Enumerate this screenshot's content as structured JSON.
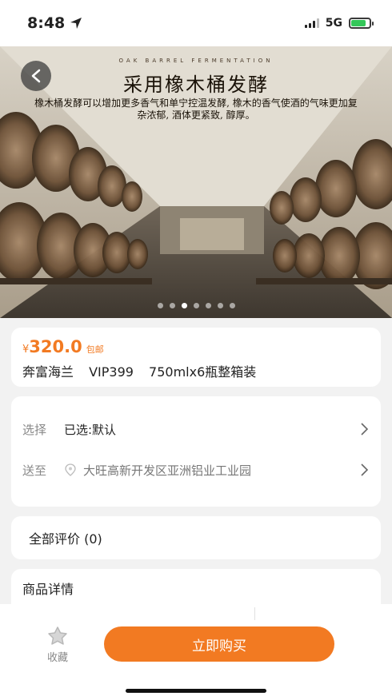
{
  "status": {
    "time": "8:48",
    "network": "5G",
    "battery_level": 0.8
  },
  "hero": {
    "subtitle": "OAK BARREL FERMENTATION",
    "title": "采用橡木桶发酵",
    "description": "橡木桶发酵可以增加更多香气和单宁控温发酵, 橡木的香气使酒的气味更加复杂浓郁, 酒体更紧致, 醇厚。",
    "slide_count": 7,
    "active_slide": 2
  },
  "product": {
    "currency": "¥",
    "price": "320.0",
    "shipping_tag": "包邮",
    "name": "奔富海兰 VIP399 750mlx6瓶整箱装"
  },
  "options": {
    "select_label": "选择",
    "select_value": "已选:默认",
    "ship_label": "送至",
    "ship_value": "大旺高新开发区亚洲铝业工业园"
  },
  "reviews": {
    "label": "全部评价 (0)"
  },
  "details": {
    "label": "商品详情"
  },
  "bottom": {
    "favorite_label": "收藏",
    "buy_label": "立即购买"
  },
  "colors": {
    "accent": "#f27a22",
    "background": "#f2f2f2"
  },
  "icons": [
    "location-arrow-icon",
    "signal-icon",
    "battery-icon",
    "back-icon",
    "location-pin-icon",
    "chevron-right-icon",
    "favorite-icon"
  ]
}
